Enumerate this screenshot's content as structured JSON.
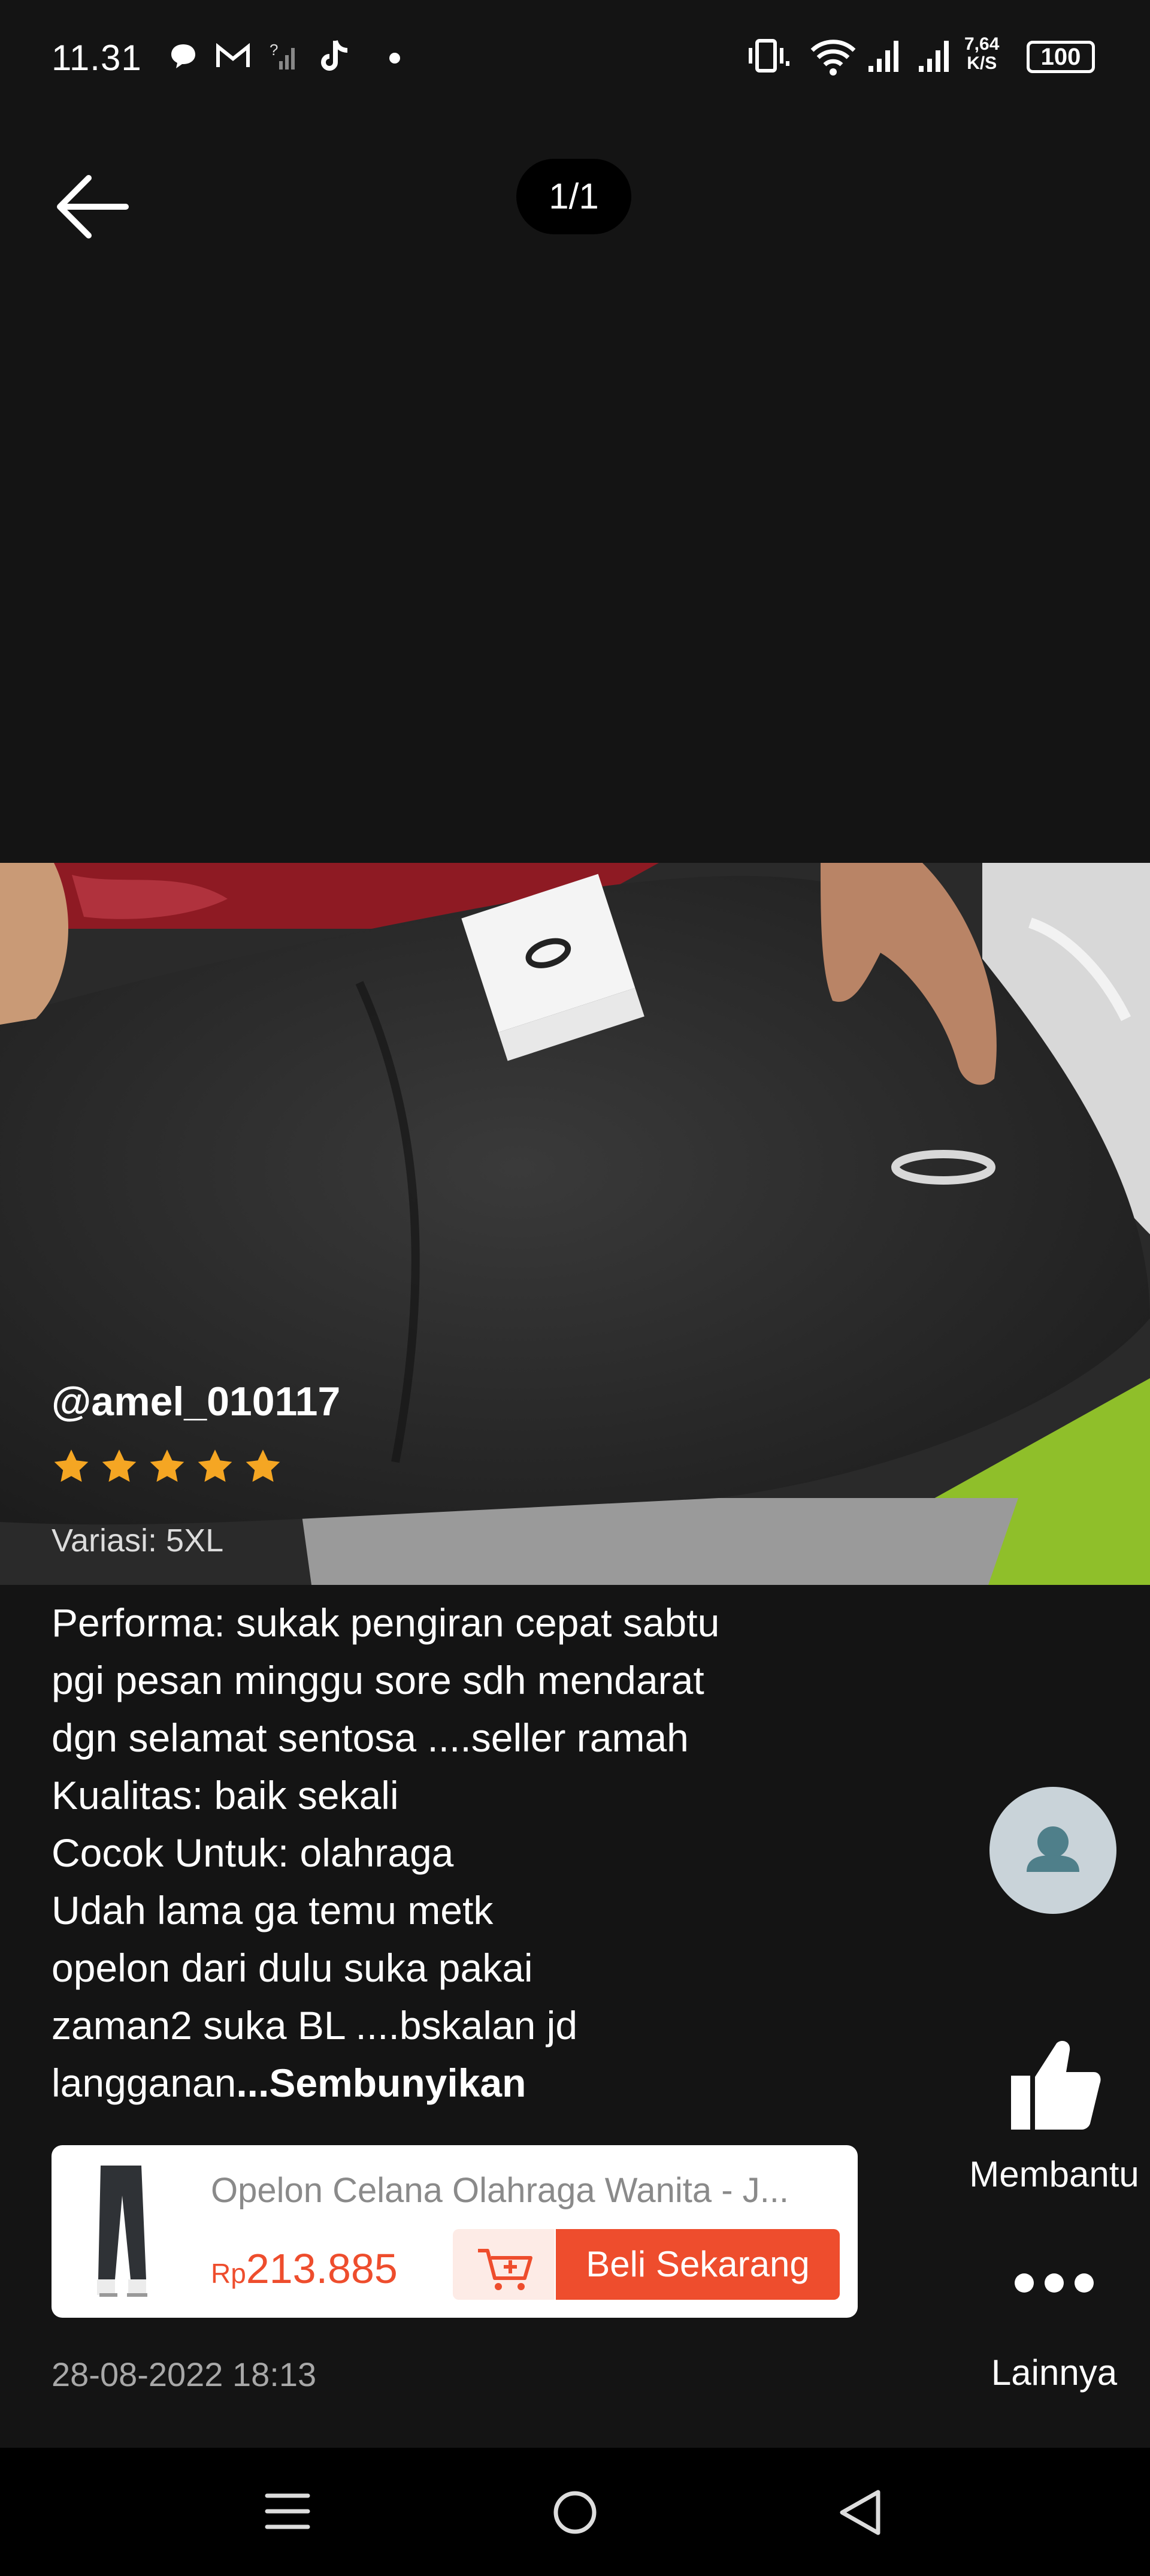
{
  "status_bar": {
    "time": "11.31",
    "speed_value": "7,64",
    "speed_unit": "K/S",
    "battery": "100",
    "icons": [
      "chat-bubble-icon",
      "gmail-icon",
      "no-signal-icon",
      "tiktok-icon",
      "dot-icon",
      "vibrate-icon",
      "wifi-icon",
      "signal-icon",
      "signal-icon"
    ]
  },
  "header": {
    "counter": "1/1"
  },
  "review": {
    "username": "@amel_010117",
    "rating": 5,
    "variant": "Variasi: 5XL",
    "text": "Performa: sukak pengiran cepat sabtu\npgi pesan minggu sore sdh mendarat\ndgn selamat sentosa ....seller ramah\nKualitas: baik sekali\nCocok Untuk: olahraga\nUdah lama ga temu metk\nopelon dari dulu suka pakai\nzaman2 suka BL ....bskalan jd\nlangganan",
    "toggle_label": "...Sembunyikan",
    "date": "28-08-2022 18:13"
  },
  "actions": {
    "helpful_label": "Membantu",
    "more_label": "Lainnya"
  },
  "product": {
    "name": "Opelon Celana Olahraga Wanita - J...",
    "currency": "Rp",
    "price": "213.885",
    "buy_label": "Beli Sekarang"
  },
  "colors": {
    "accent": "#ee4d2d",
    "star": "#f5a623",
    "background": "#141414"
  }
}
